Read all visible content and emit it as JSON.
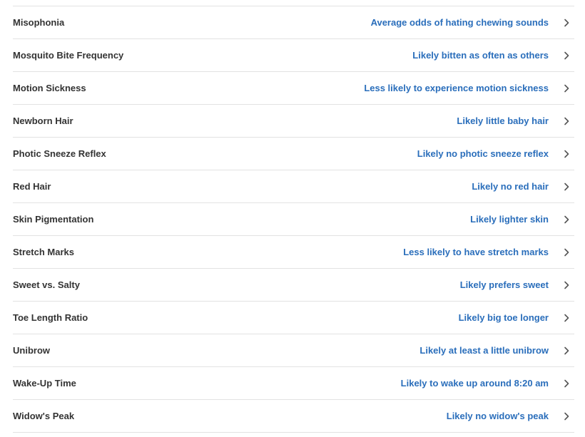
{
  "colors": {
    "trait_name": "#333333",
    "trait_result": "#2a6ebb",
    "divider": "#e2e2e2",
    "chevron": "#555555"
  },
  "icons": {
    "row_chevron": "chevron-right-icon"
  },
  "traits": [
    {
      "name": "Misophonia",
      "result": "Average odds of hating chewing sounds"
    },
    {
      "name": "Mosquito Bite Frequency",
      "result": "Likely bitten as often as others"
    },
    {
      "name": "Motion Sickness",
      "result": "Less likely to experience motion sickness"
    },
    {
      "name": "Newborn Hair",
      "result": "Likely little baby hair"
    },
    {
      "name": "Photic Sneeze Reflex",
      "result": "Likely no photic sneeze reflex"
    },
    {
      "name": "Red Hair",
      "result": "Likely no red hair"
    },
    {
      "name": "Skin Pigmentation",
      "result": "Likely lighter skin"
    },
    {
      "name": "Stretch Marks",
      "result": "Less likely to have stretch marks"
    },
    {
      "name": "Sweet vs. Salty",
      "result": "Likely prefers sweet"
    },
    {
      "name": "Toe Length Ratio",
      "result": "Likely big toe longer"
    },
    {
      "name": "Unibrow",
      "result": "Likely at least a little unibrow"
    },
    {
      "name": "Wake-Up Time",
      "result": "Likely to wake up around 8:20 am"
    },
    {
      "name": "Widow's Peak",
      "result": "Likely no widow's peak"
    }
  ]
}
